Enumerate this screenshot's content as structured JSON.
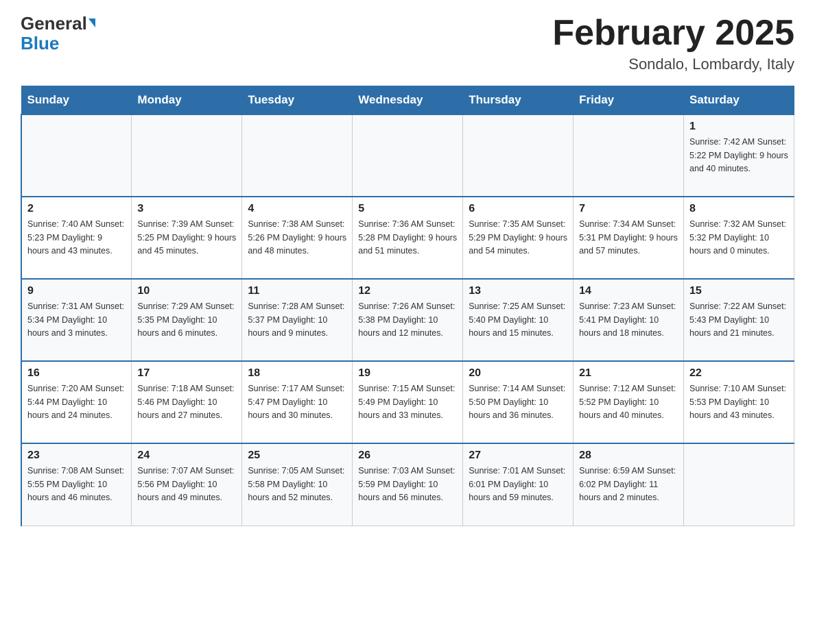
{
  "header": {
    "logo_general": "General",
    "logo_blue": "Blue",
    "month_title": "February 2025",
    "location": "Sondalo, Lombardy, Italy"
  },
  "days_of_week": [
    "Sunday",
    "Monday",
    "Tuesday",
    "Wednesday",
    "Thursday",
    "Friday",
    "Saturday"
  ],
  "weeks": [
    [
      {
        "day": "",
        "info": ""
      },
      {
        "day": "",
        "info": ""
      },
      {
        "day": "",
        "info": ""
      },
      {
        "day": "",
        "info": ""
      },
      {
        "day": "",
        "info": ""
      },
      {
        "day": "",
        "info": ""
      },
      {
        "day": "1",
        "info": "Sunrise: 7:42 AM\nSunset: 5:22 PM\nDaylight: 9 hours and 40 minutes."
      }
    ],
    [
      {
        "day": "2",
        "info": "Sunrise: 7:40 AM\nSunset: 5:23 PM\nDaylight: 9 hours and 43 minutes."
      },
      {
        "day": "3",
        "info": "Sunrise: 7:39 AM\nSunset: 5:25 PM\nDaylight: 9 hours and 45 minutes."
      },
      {
        "day": "4",
        "info": "Sunrise: 7:38 AM\nSunset: 5:26 PM\nDaylight: 9 hours and 48 minutes."
      },
      {
        "day": "5",
        "info": "Sunrise: 7:36 AM\nSunset: 5:28 PM\nDaylight: 9 hours and 51 minutes."
      },
      {
        "day": "6",
        "info": "Sunrise: 7:35 AM\nSunset: 5:29 PM\nDaylight: 9 hours and 54 minutes."
      },
      {
        "day": "7",
        "info": "Sunrise: 7:34 AM\nSunset: 5:31 PM\nDaylight: 9 hours and 57 minutes."
      },
      {
        "day": "8",
        "info": "Sunrise: 7:32 AM\nSunset: 5:32 PM\nDaylight: 10 hours and 0 minutes."
      }
    ],
    [
      {
        "day": "9",
        "info": "Sunrise: 7:31 AM\nSunset: 5:34 PM\nDaylight: 10 hours and 3 minutes."
      },
      {
        "day": "10",
        "info": "Sunrise: 7:29 AM\nSunset: 5:35 PM\nDaylight: 10 hours and 6 minutes."
      },
      {
        "day": "11",
        "info": "Sunrise: 7:28 AM\nSunset: 5:37 PM\nDaylight: 10 hours and 9 minutes."
      },
      {
        "day": "12",
        "info": "Sunrise: 7:26 AM\nSunset: 5:38 PM\nDaylight: 10 hours and 12 minutes."
      },
      {
        "day": "13",
        "info": "Sunrise: 7:25 AM\nSunset: 5:40 PM\nDaylight: 10 hours and 15 minutes."
      },
      {
        "day": "14",
        "info": "Sunrise: 7:23 AM\nSunset: 5:41 PM\nDaylight: 10 hours and 18 minutes."
      },
      {
        "day": "15",
        "info": "Sunrise: 7:22 AM\nSunset: 5:43 PM\nDaylight: 10 hours and 21 minutes."
      }
    ],
    [
      {
        "day": "16",
        "info": "Sunrise: 7:20 AM\nSunset: 5:44 PM\nDaylight: 10 hours and 24 minutes."
      },
      {
        "day": "17",
        "info": "Sunrise: 7:18 AM\nSunset: 5:46 PM\nDaylight: 10 hours and 27 minutes."
      },
      {
        "day": "18",
        "info": "Sunrise: 7:17 AM\nSunset: 5:47 PM\nDaylight: 10 hours and 30 minutes."
      },
      {
        "day": "19",
        "info": "Sunrise: 7:15 AM\nSunset: 5:49 PM\nDaylight: 10 hours and 33 minutes."
      },
      {
        "day": "20",
        "info": "Sunrise: 7:14 AM\nSunset: 5:50 PM\nDaylight: 10 hours and 36 minutes."
      },
      {
        "day": "21",
        "info": "Sunrise: 7:12 AM\nSunset: 5:52 PM\nDaylight: 10 hours and 40 minutes."
      },
      {
        "day": "22",
        "info": "Sunrise: 7:10 AM\nSunset: 5:53 PM\nDaylight: 10 hours and 43 minutes."
      }
    ],
    [
      {
        "day": "23",
        "info": "Sunrise: 7:08 AM\nSunset: 5:55 PM\nDaylight: 10 hours and 46 minutes."
      },
      {
        "day": "24",
        "info": "Sunrise: 7:07 AM\nSunset: 5:56 PM\nDaylight: 10 hours and 49 minutes."
      },
      {
        "day": "25",
        "info": "Sunrise: 7:05 AM\nSunset: 5:58 PM\nDaylight: 10 hours and 52 minutes."
      },
      {
        "day": "26",
        "info": "Sunrise: 7:03 AM\nSunset: 5:59 PM\nDaylight: 10 hours and 56 minutes."
      },
      {
        "day": "27",
        "info": "Sunrise: 7:01 AM\nSunset: 6:01 PM\nDaylight: 10 hours and 59 minutes."
      },
      {
        "day": "28",
        "info": "Sunrise: 6:59 AM\nSunset: 6:02 PM\nDaylight: 11 hours and 2 minutes."
      },
      {
        "day": "",
        "info": ""
      }
    ]
  ]
}
